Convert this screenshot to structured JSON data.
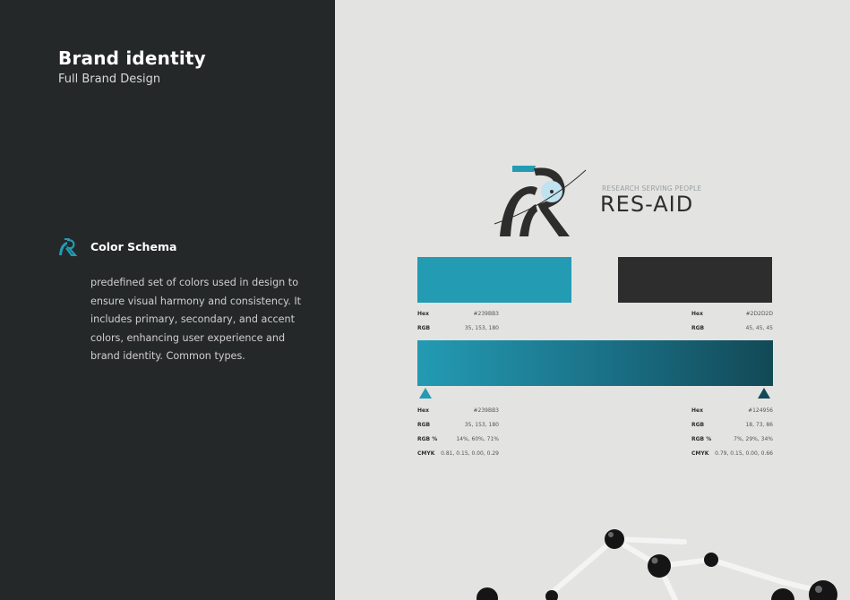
{
  "header": {
    "title": "Brand identity",
    "subtitle": "Full Brand Design"
  },
  "section": {
    "icon": "res-aid-logo-icon",
    "title": "Color Schema",
    "description": "predefined set of colors used in design to ensure visual harmony and consistency. It includes primary, secondary, and accent colors, enhancing user experience and brand identity. Common types."
  },
  "logo": {
    "tagline": "RESEARCH SERVING PEOPLE",
    "name": "RES-AID"
  },
  "colors": {
    "primary": {
      "hex_label": "Hex",
      "hex": "#239BB3",
      "rgb_label": "RGB",
      "rgb": "35, 153, 180"
    },
    "secondary": {
      "hex_label": "Hex",
      "hex": "#2D2D2D",
      "rgb_label": "RGB",
      "rgb": "45, 45, 45"
    }
  },
  "gradient": {
    "start": {
      "hex_label": "Hex",
      "hex": "#239BB3",
      "rgb_label": "RGB",
      "rgb": "35, 153, 180",
      "rgbp_label": "RGB %",
      "rgbp": "14%, 60%, 71%",
      "cmyk_label": "CMYK",
      "cmyk": "0.81, 0.15, 0.00, 0.29"
    },
    "end": {
      "hex_label": "Hex",
      "hex": "#124956",
      "rgb_label": "RGB",
      "rgb": "18, 73, 86",
      "rgbp_label": "RGB %",
      "rgbp": "7%, 29%, 34%",
      "cmyk_label": "CMYK",
      "cmyk": "0.79, 0.15, 0.00, 0.66"
    }
  },
  "palette": {
    "brand_teal": "#239bb3",
    "dark": "#2d2d2d",
    "deep_teal": "#124956",
    "panel_bg": "#252829",
    "page_bg": "#e3e3e1"
  }
}
